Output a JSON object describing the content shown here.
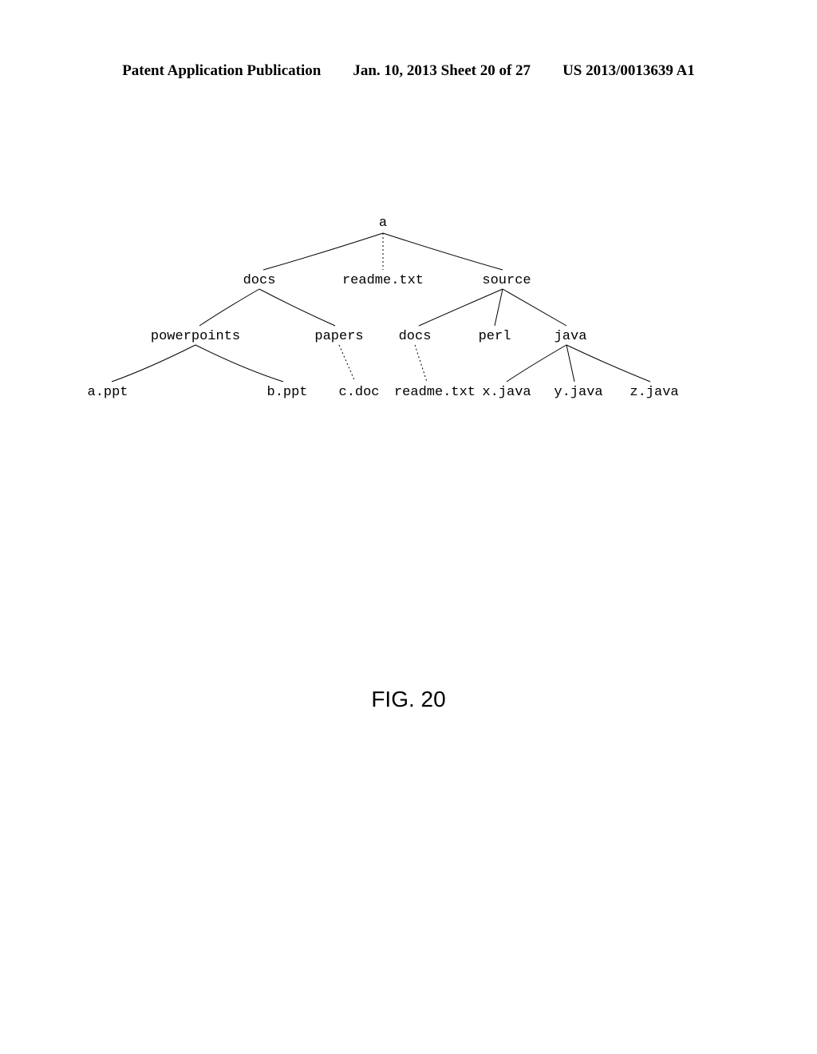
{
  "header": {
    "left": "Patent Application Publication",
    "center": "Jan. 10, 2013  Sheet 20 of 27",
    "right": "US 2013/0013639 A1"
  },
  "tree": {
    "root": "a",
    "level1": {
      "docs": "docs",
      "readme": "readme.txt",
      "source": "source"
    },
    "level2": {
      "powerpoints": "powerpoints",
      "papers": "papers",
      "docs2": "docs",
      "perl": "perl",
      "java": "java"
    },
    "level3": {
      "appt": "a.ppt",
      "bppt": "b.ppt",
      "cdoc": "c.doc",
      "readme2": "readme.txt",
      "xjava": "x.java",
      "yjava": "y.java",
      "zjava": "z.java"
    }
  },
  "figure_caption": "FIG. 20"
}
